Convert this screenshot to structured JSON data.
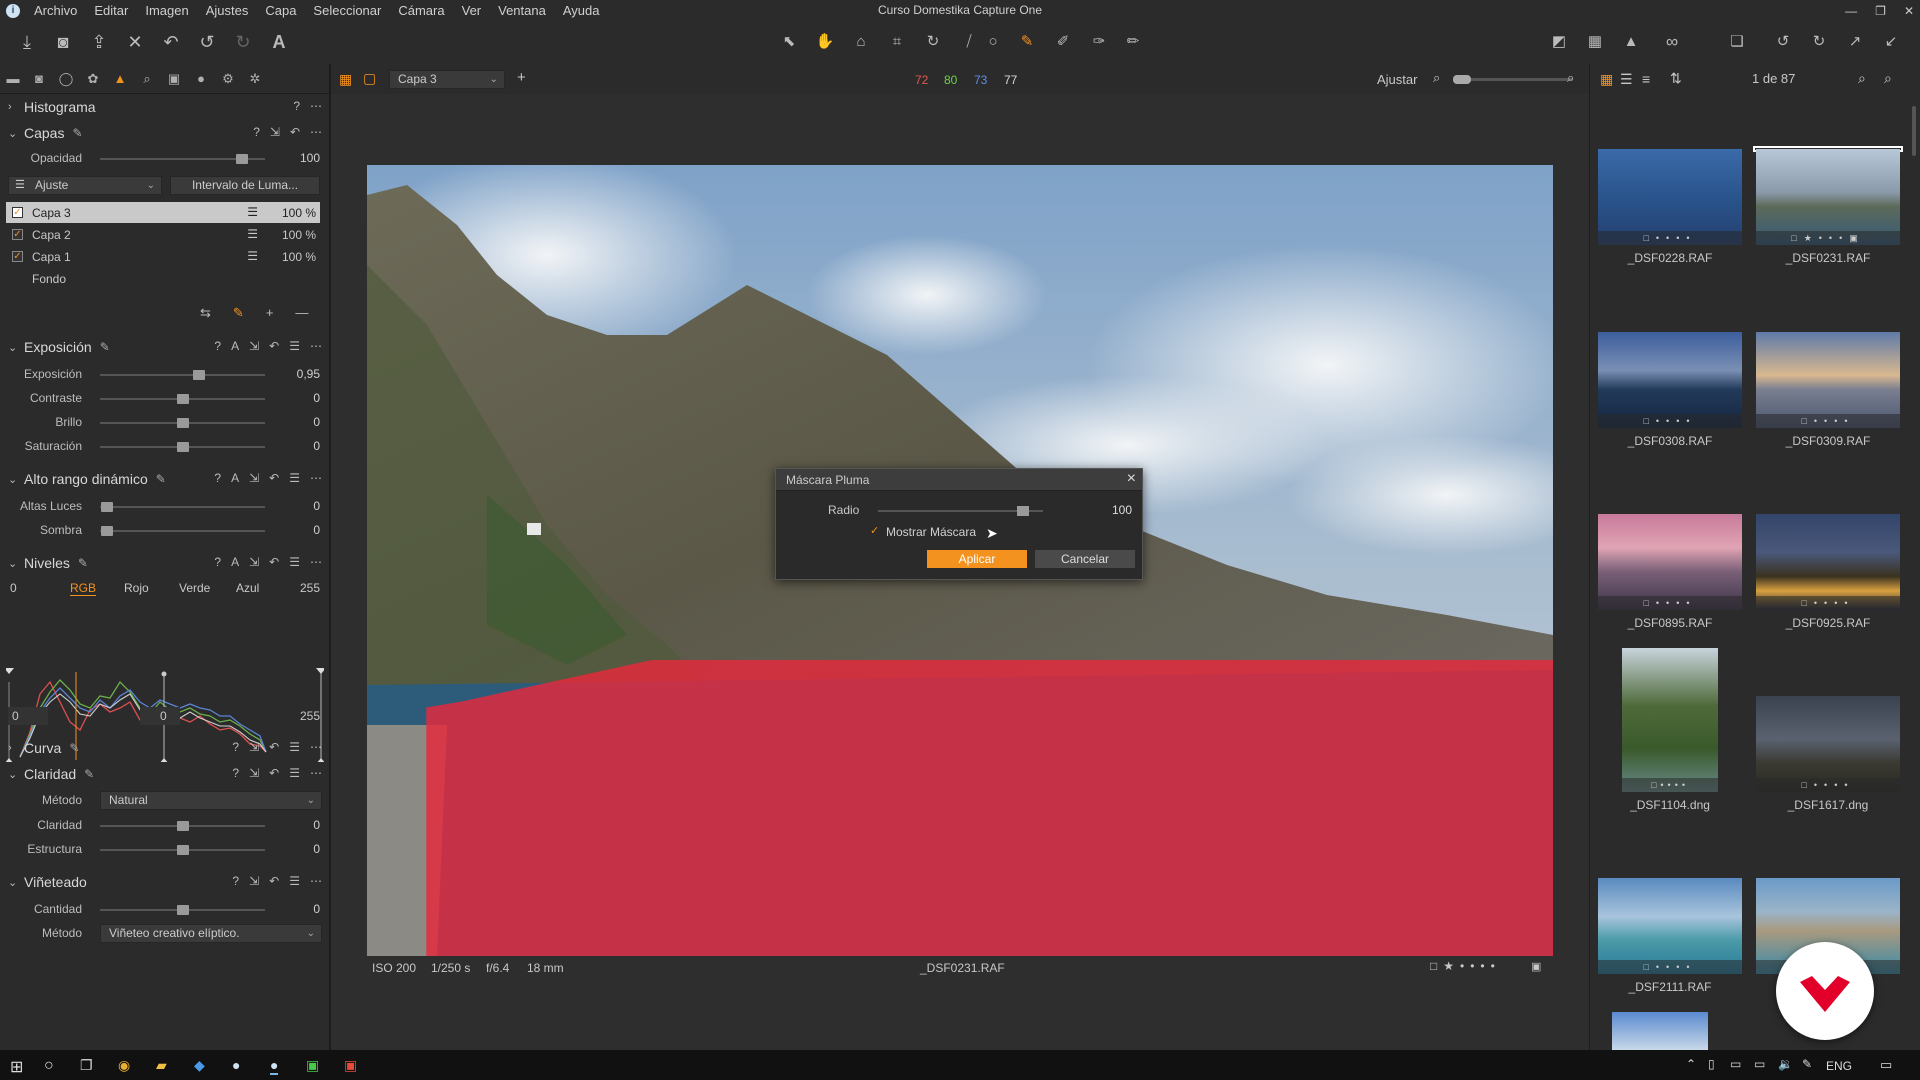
{
  "window": {
    "title": "Curso Domestika Capture One",
    "app_icon_glyph": "i"
  },
  "menu": [
    "Archivo",
    "Editar",
    "Imagen",
    "Ajustes",
    "Capa",
    "Seleccionar",
    "Cámara",
    "Ver",
    "Ventana",
    "Ayuda"
  ],
  "viewer_toolbar": {
    "layer_select": "Capa 3",
    "readout": {
      "r": "72",
      "g": "80",
      "b": "73",
      "l": "77"
    },
    "fit_label": "Ajustar",
    "counter": "1 de 87"
  },
  "histogram": {
    "title": "Histograma"
  },
  "layers": {
    "title": "Capas",
    "opacity_label": "Opacidad",
    "opacity_value": "100",
    "opacity_level": 0.86,
    "mode_select": "Ajuste",
    "luma_button": "Intervalo de Luma...",
    "items": [
      {
        "name": "Capa 3",
        "pct": "100 %"
      },
      {
        "name": "Capa 2",
        "pct": "100 %"
      },
      {
        "name": "Capa 1",
        "pct": "100 %"
      }
    ],
    "background": "Fondo"
  },
  "exposure": {
    "title": "Exposición",
    "rows": [
      {
        "label": "Exposición",
        "value": "0,95",
        "level": 0.6
      },
      {
        "label": "Contraste",
        "value": "0",
        "level": 0.5
      },
      {
        "label": "Brillo",
        "value": "0",
        "level": 0.5
      },
      {
        "label": "Saturación",
        "value": "0",
        "level": 0.5
      }
    ]
  },
  "hdr": {
    "title": "Alto rango dinámico",
    "rows": [
      {
        "label": "Altas Luces",
        "value": "0",
        "level": 0.04
      },
      {
        "label": "Sombra",
        "value": "0",
        "level": 0.04
      }
    ]
  },
  "levels": {
    "title": "Niveles",
    "in_min": "0",
    "in_max": "255",
    "channels": [
      "RGB",
      "Rojo",
      "Verde",
      "Azul"
    ],
    "out_min": "0",
    "out_mid": "0",
    "out_max": "255"
  },
  "curve": {
    "title": "Curva"
  },
  "clarity": {
    "title": "Claridad",
    "method_label": "Método",
    "method_value": "Natural",
    "rows": [
      {
        "label": "Claridad",
        "value": "0",
        "level": 0.5
      },
      {
        "label": "Estructura",
        "value": "0",
        "level": 0.5
      }
    ]
  },
  "vignetting": {
    "title": "Viñeteado",
    "rows": [
      {
        "label": "Cantidad",
        "value": "0",
        "level": 0.5
      }
    ],
    "method_label": "Método",
    "method_value": "Viñeteo creativo elíptico."
  },
  "photo_info": {
    "iso": "ISO 200",
    "shutter": "1/250 s",
    "aperture": "f/6.4",
    "focal": "18 mm",
    "filename": "_DSF0231.RAF"
  },
  "dialog": {
    "title": "Máscara Pluma",
    "radius_label": "Radio",
    "radius_value": "100",
    "radius_level": 0.88,
    "show_mask_label": "Mostrar Máscara",
    "apply": "Aplicar",
    "cancel": "Cancelar"
  },
  "thumbnails": [
    "_DSF0228.RAF",
    "_DSF0231.RAF",
    "_DSF0308.RAF",
    "_DSF0309.RAF",
    "_DSF0895.RAF",
    "_DSF0925.RAF",
    "_DSF1104.dng",
    "_DSF1617.dng",
    "_DSF2111.RAF"
  ],
  "taskbar": {
    "lang": "ENG"
  },
  "colors": {
    "accent": "#f3921f",
    "mask": "#e6283c"
  }
}
